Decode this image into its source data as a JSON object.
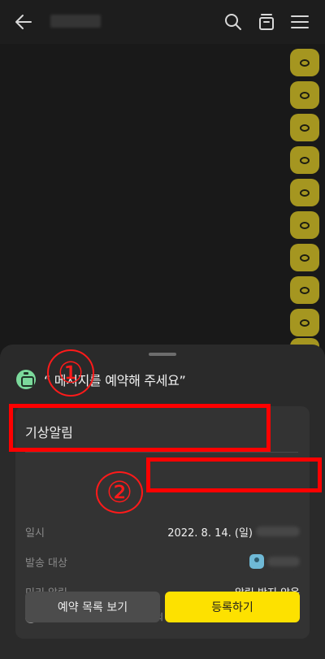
{
  "header": {
    "icons": [
      "back-arrow-icon",
      "search-icon",
      "archive-box-icon",
      "hamburger-menu-icon"
    ]
  },
  "chat": {
    "bubbles": [
      "o",
      "o",
      "o",
      "o",
      "o",
      "o",
      "o",
      "o",
      "o",
      "o"
    ],
    "bubble_color": "#a59620"
  },
  "sheet": {
    "title": "“ 메시지를 예약해 주세요”",
    "message_value": "기상알림",
    "rows": {
      "date_label": "일시",
      "date_value": "2022. 8. 14. (일)",
      "target_label": "발송 대상",
      "alarm_label": "미리 알림",
      "alarm_value": "알림 받지 않음"
    },
    "notice": "예약 메시지가 많을 경우, 약간의 시간 오차가 발생할 수 있습니다.",
    "notice_icon": "!",
    "buttons": {
      "list_label": "예약 목록 보기",
      "register_label": "등록하기"
    }
  },
  "annotations": {
    "circle_1": "①",
    "circle_2": "②",
    "color": "#ff0000"
  }
}
